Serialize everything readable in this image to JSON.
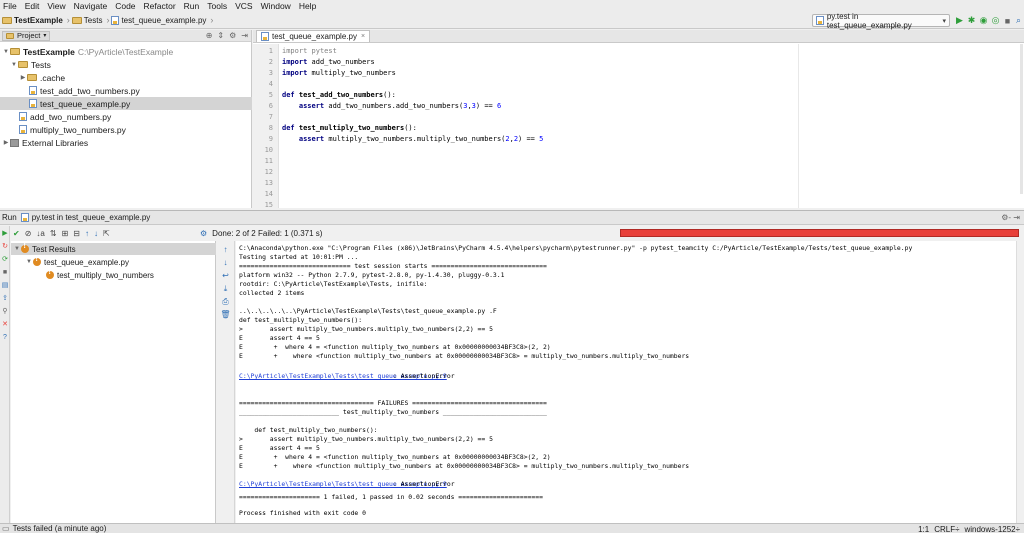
{
  "menu": [
    "File",
    "Edit",
    "View",
    "Navigate",
    "Code",
    "Refactor",
    "Run",
    "Tools",
    "VCS",
    "Window",
    "Help"
  ],
  "breadcrumbs": [
    "TestExample",
    "Tests",
    "test_queue_example.py"
  ],
  "run_config": {
    "label": "py.test in test_queue_example.py"
  },
  "colors": {
    "run_green": "#2e9e3a",
    "fail_red": "#e8403a",
    "link_blue": "#1f3fd6",
    "keyword_navy": "#000080"
  },
  "project": {
    "tab_label": "Project",
    "tree": [
      {
        "label": "TestExample",
        "path": "C:\\PyArticle\\TestExample"
      },
      {
        "label": "Tests"
      },
      {
        "label": ".cache"
      },
      {
        "label": "test_add_two_numbers.py"
      },
      {
        "label": "test_queue_example.py"
      },
      {
        "label": "add_two_numbers.py"
      },
      {
        "label": "multiply_two_numbers.py"
      },
      {
        "label": "External Libraries"
      }
    ]
  },
  "editor": {
    "tab_label": "test_queue_example.py",
    "line_numbers": [
      "1",
      "2",
      "3",
      "4",
      "5",
      "6",
      "7",
      "8",
      "9",
      "10",
      "11",
      "12",
      "13",
      "14",
      "15"
    ]
  },
  "run": {
    "title": "Run",
    "config": "py.test in test_queue_example.py",
    "status": "Done: 2 of 2  Failed: 1  (0.371 s)",
    "progress_failed_fraction": 0.5,
    "tree": {
      "root": "Test Results",
      "file": "test_queue_example.py",
      "test": "test_multiply_two_numbers"
    },
    "console": [
      "C:\\Anaconda\\python.exe \"C:\\Program Files (x86)\\JetBrains\\PyCharm 4.5.4\\helpers\\pycharm\\pytestrunner.py\" -p pytest_teamcity C:/PyArticle/TestExample/Tests/test_queue_example.py",
      "Testing started at 10:01:PM ...",
      "============================= test session starts ==============================",
      "platform win32 -- Python 2.7.9, pytest-2.8.0, py-1.4.30, pluggy-0.3.1",
      "rootdir: C:\\PyArticle\\TestExample\\Tests, inifile:",
      "collected 2 items",
      "",
      "..\\..\\..\\..\\..\\PyArticle\\TestExample\\Tests\\test_queue_example.py .F",
      "def test_multiply_two_numbers():",
      ">       assert multiply_two_numbers.multiply_two_numbers(2,2) == 5",
      "E       assert 4 == 5",
      "E        +  where 4 = <function multiply_two_numbers at 0x00000000034BF3C8>(2, 2)",
      "E        +    where <function multiply_two_numbers at 0x00000000034BF3C8> = multiply_two_numbers.multiply_two_numbers",
      "",
      "C:\\PyArticle\\TestExample\\Tests\\test_queue_example.py:9",
      ": AssertionError",
      "",
      "",
      "=================================== FAILURES ===================================",
      "__________________________ test_multiply_two_numbers ___________________________",
      "",
      "    def test_multiply_two_numbers():",
      ">       assert multiply_two_numbers.multiply_two_numbers(2,2) == 5",
      "E       assert 4 == 5",
      "E        +  where 4 = <function multiply_two_numbers at 0x00000000034BF3C8>(2, 2)",
      "E        +    where <function multiply_two_numbers at 0x00000000034BF3C8> = multiply_two_numbers.multiply_two_numbers",
      "",
      "C:\\PyArticle\\TestExample\\Tests\\test_queue_example.py:9",
      ": AssertionError",
      "===================== 1 failed, 1 passed in 0.02 seconds ======================",
      "",
      "Process finished with exit code 0"
    ]
  },
  "statusbar": {
    "message": "Tests failed (a minute ago)",
    "position": "1:1",
    "line_sep": "CRLF÷",
    "encoding": "windows-1252÷"
  }
}
